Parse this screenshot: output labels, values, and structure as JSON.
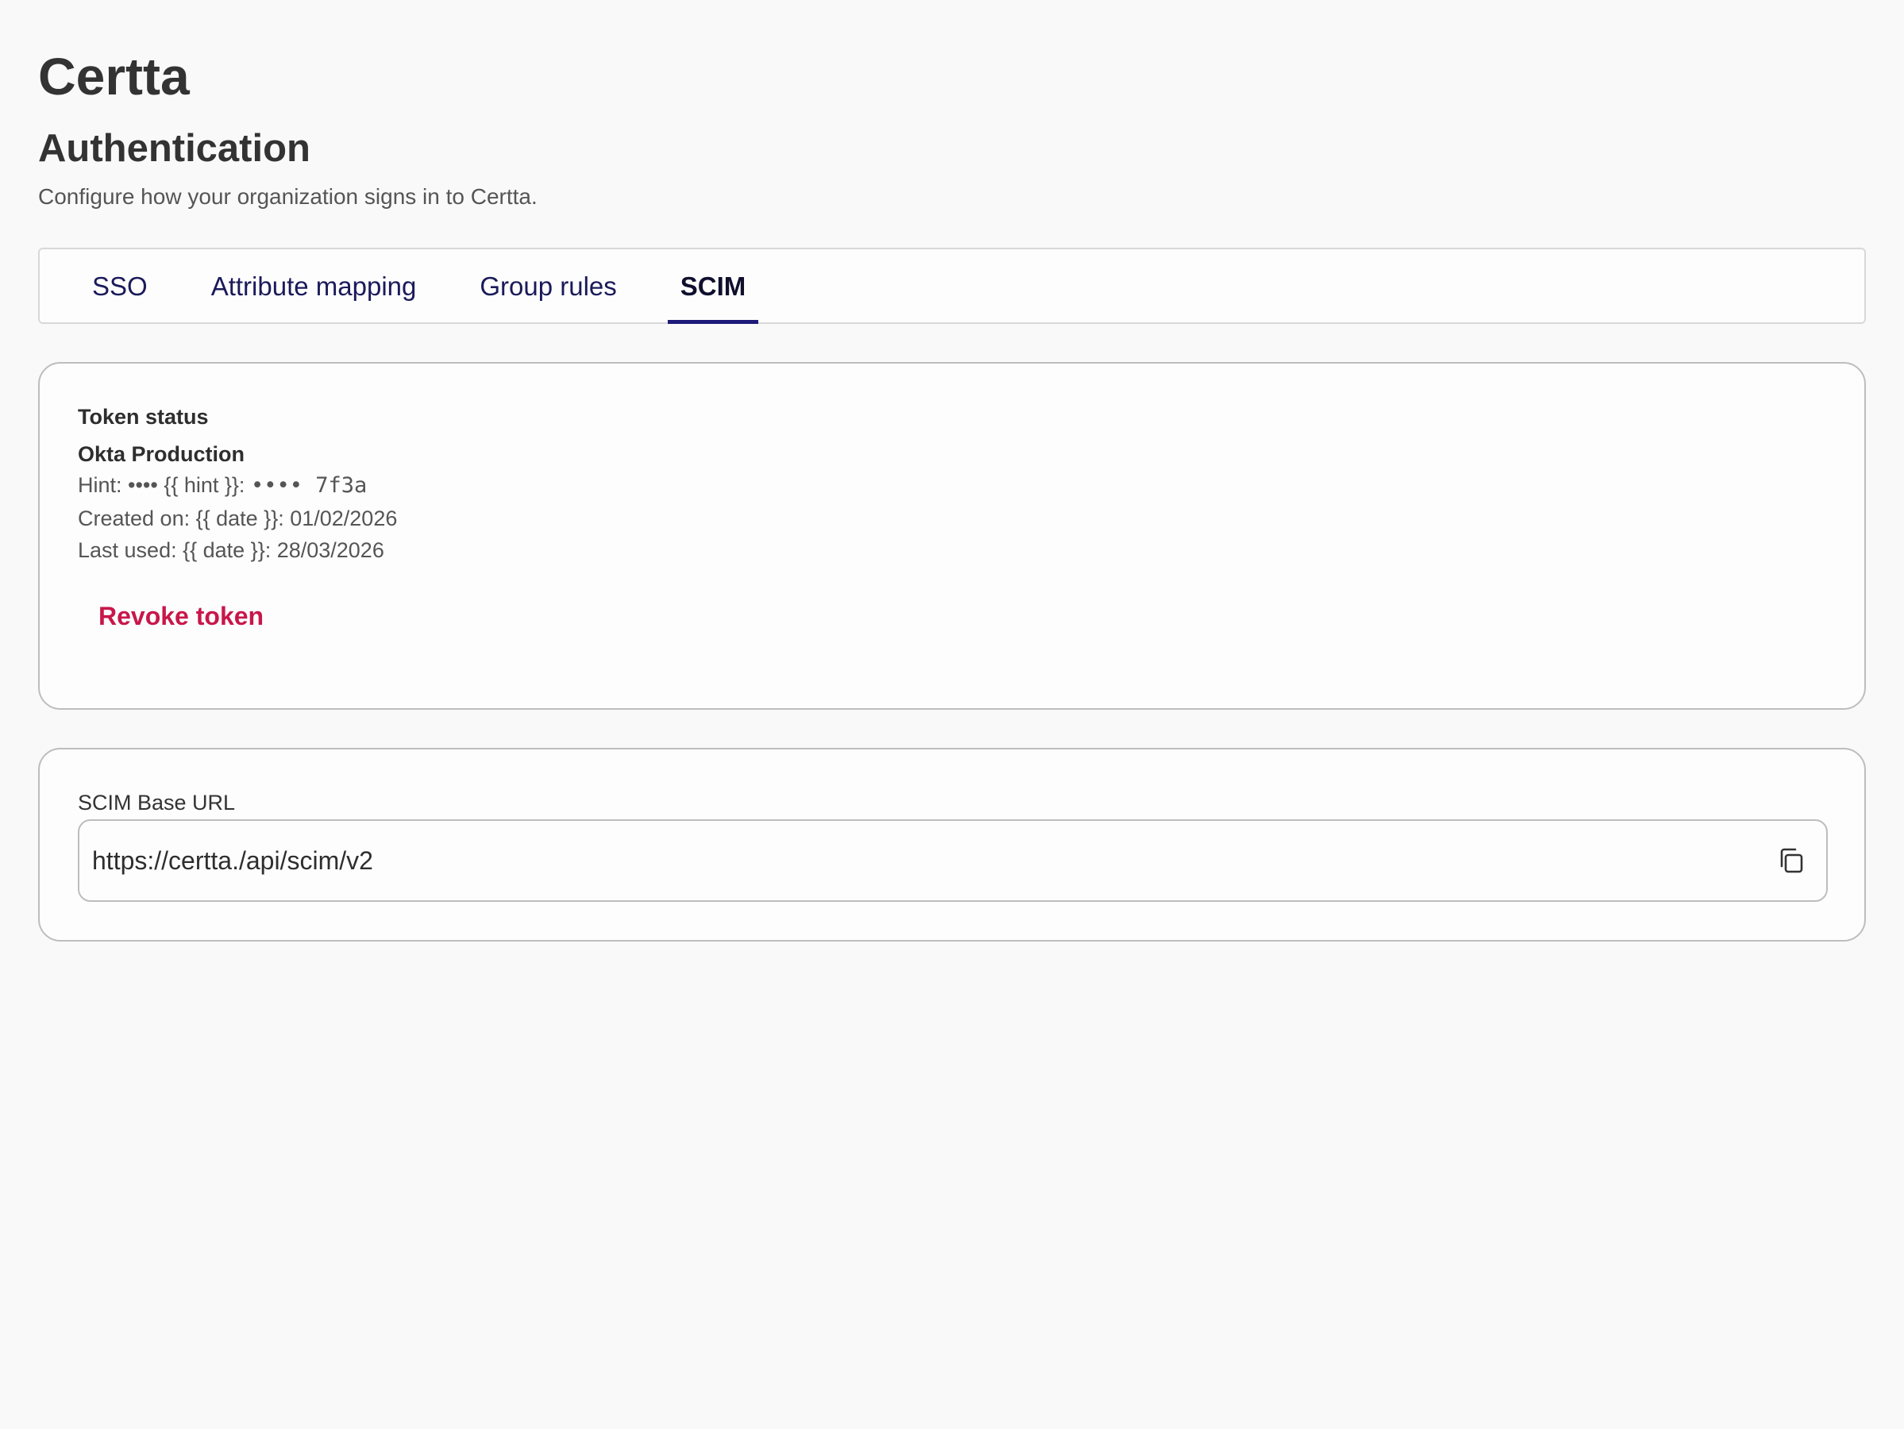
{
  "header": {
    "app_title": "Certta",
    "section_title": "Authentication",
    "section_description": "Configure how your organization signs in to Certta."
  },
  "tabs": [
    {
      "label": "SSO",
      "active": false
    },
    {
      "label": "Attribute mapping",
      "active": false
    },
    {
      "label": "Group rules",
      "active": false
    },
    {
      "label": "SCIM",
      "active": true
    }
  ],
  "token_card": {
    "heading": "Token status",
    "name": "Okta Production",
    "hint_label": "Hint: •••• {{ hint }}:",
    "hint_value": "•••• 7f3a",
    "created_text": "Created on: {{ date }}: 01/02/2026",
    "last_used_text": "Last used: {{ date }}: 28/03/2026",
    "revoke_label": "Revoke token"
  },
  "url_card": {
    "label": "SCIM Base URL",
    "value": "https://certta./api/scim/v2",
    "copy_icon": "copy-icon"
  },
  "colors": {
    "accent": "#1e1a7a",
    "danger": "#c8174a",
    "background": "#f9f9f9"
  }
}
